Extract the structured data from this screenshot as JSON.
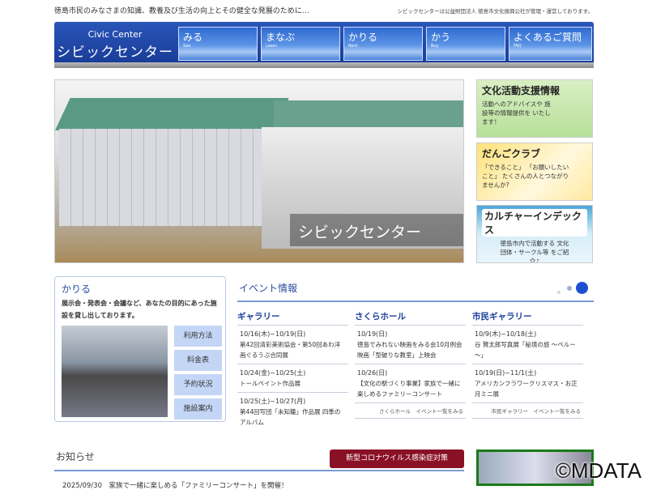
{
  "top": {
    "tagline": "徳島市民のみなさまの知識、教養及び生活の向上とその健全な発展のために…",
    "operator": "シビックセンターは公益財団法人 徳島市文化振興公社が管理・運営しております。"
  },
  "logo": {
    "en": "Civic Center",
    "ja": "シビックセンター"
  },
  "nav": [
    {
      "ja": "みる",
      "en": "See"
    },
    {
      "ja": "まなぶ",
      "en": "Learn"
    },
    {
      "ja": "かりる",
      "en": "Rent"
    },
    {
      "ja": "かう",
      "en": "Buy"
    },
    {
      "ja": "よくあるご質問",
      "en": "FAQ"
    }
  ],
  "hero": {
    "caption": "シビックセンター"
  },
  "banners": [
    {
      "title": "文化活動支援情報",
      "desc": "活動へのアドバイスや 施設等の情報提供を いたします！"
    },
    {
      "title": "だんごクラブ",
      "desc": "「できること」 「お願いしたいこと」 たくさんの人とつながりませんか?"
    },
    {
      "title": "カルチャーインデックス",
      "desc": "徳島市内で活動する 文化団体・サークル等 をご紹介♪"
    }
  ],
  "kariru": {
    "title": "かりる",
    "desc": "展示会・発表会・会議など、あなたの目的にあった施設を貸し出しております。",
    "buttons": [
      "利用方法",
      "料金表",
      "予約状況",
      "施設案内"
    ]
  },
  "events": {
    "title": "イベント情報",
    "columns": [
      {
        "name": "ギャラリー",
        "items": [
          {
            "date": "10/16(木)~10/19(日)",
            "title": "第42回清彩美術協会・第50回あわ洋画ぐるうぷ合同展"
          },
          {
            "date": "10/24(金)~10/25(土)",
            "title": "トールペイント作品展"
          },
          {
            "date": "10/25(土)~10/27(月)",
            "title": "第44回写団「未知籠」作品展 四季のアルバム"
          }
        ],
        "more": ""
      },
      {
        "name": "さくらホール",
        "items": [
          {
            "date": "10/19(日)",
            "title": "徳島でみれない映画をみる会10月例会 映画「型破りな教室」上映会"
          },
          {
            "date": "10/26(日)",
            "title": "【文化の駅づくり事業】家族で一緒に楽しめるファミリーコンサート"
          }
        ],
        "more": "さくらホール　イベント一覧をみる"
      },
      {
        "name": "市民ギャラリー",
        "items": [
          {
            "date": "10/9(木)~10/18(土)",
            "title": "谷 賢太郎写真展「秘境の旅 ～ペルー～」"
          },
          {
            "date": "10/19(日)~11/1(土)",
            "title": "アメリカンフラワークリスマス・お正月ミニ展"
          }
        ],
        "more": "市民ギャラリー　イベント一覧をみる"
      }
    ]
  },
  "news": {
    "title": "お知らせ",
    "covid_button": "新型コロナウイルス感染症対策",
    "first_item": "2025/09/30　家族で一緒に楽しめる「ファミリーコンサート」を開催！"
  },
  "watermark": "©MDATA",
  "colors": {
    "header": "#1a3d9a",
    "covid": "#8a1026",
    "accent": "#2a4ca0"
  }
}
